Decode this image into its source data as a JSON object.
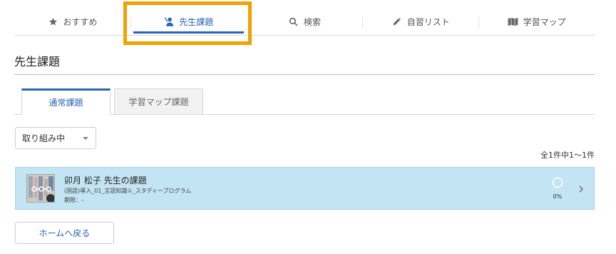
{
  "nav": {
    "items": [
      {
        "label": "おすすめ",
        "icon": "star-icon",
        "active": false
      },
      {
        "label": "先生課題",
        "icon": "teacher-icon",
        "active": true
      },
      {
        "label": "検索",
        "icon": "search-icon",
        "active": false
      },
      {
        "label": "自習リスト",
        "icon": "pencil-icon",
        "active": false
      },
      {
        "label": "学習マップ",
        "icon": "map-icon",
        "active": false
      }
    ],
    "highlight_color": "#f0a200",
    "accent_color": "#2a64b4"
  },
  "page": {
    "title": "先生課題"
  },
  "tabs": [
    {
      "label": "通常課題",
      "active": true
    },
    {
      "label": "学習マップ課題",
      "active": false
    }
  ],
  "filter": {
    "selected": "取り組み中"
  },
  "result_count": "全1件中1〜1件",
  "assignments": [
    {
      "title": "卯月 松子 先生の課題",
      "subtitle": "(国語)導入_01_言語知識①_スタディープログラム",
      "deadline": "期限：-",
      "progress_text": "0%",
      "progress": 0
    }
  ],
  "back_button": "ホームへ戻る"
}
